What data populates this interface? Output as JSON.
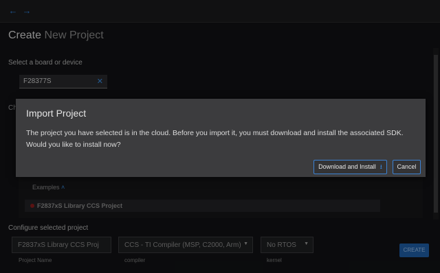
{
  "nav": {
    "back_icon": "arrow-left-icon",
    "forward_icon": "arrow-right-icon",
    "accent": "#2f7fd8"
  },
  "page": {
    "title_primary": "Create",
    "title_secondary": "New Project",
    "board_label": "Select a board or device",
    "board_value": "F28377S",
    "partial_label": "Ch"
  },
  "examples": {
    "header": "Examples",
    "rows": [
      {
        "label": "F2837xS Library CCS Project"
      }
    ]
  },
  "configure": {
    "label": "Configure selected project",
    "project_name_value": "F2837xS Library CCS Proj",
    "project_name_caption": "Project Name",
    "compiler_value": "CCS - TI Compiler (MSP, C2000, Arm)",
    "compiler_caption": "compiler",
    "kernel_value": "No RTOS",
    "kernel_caption": "kernel",
    "create_label": "CREATE"
  },
  "modal": {
    "title": "Import Project",
    "body": "The project you have selected is in the cloud. Before you import it, you must download and install the associated SDK. Would you like to install now?",
    "primary_label": "Download and Install",
    "cancel_label": "Cancel"
  }
}
